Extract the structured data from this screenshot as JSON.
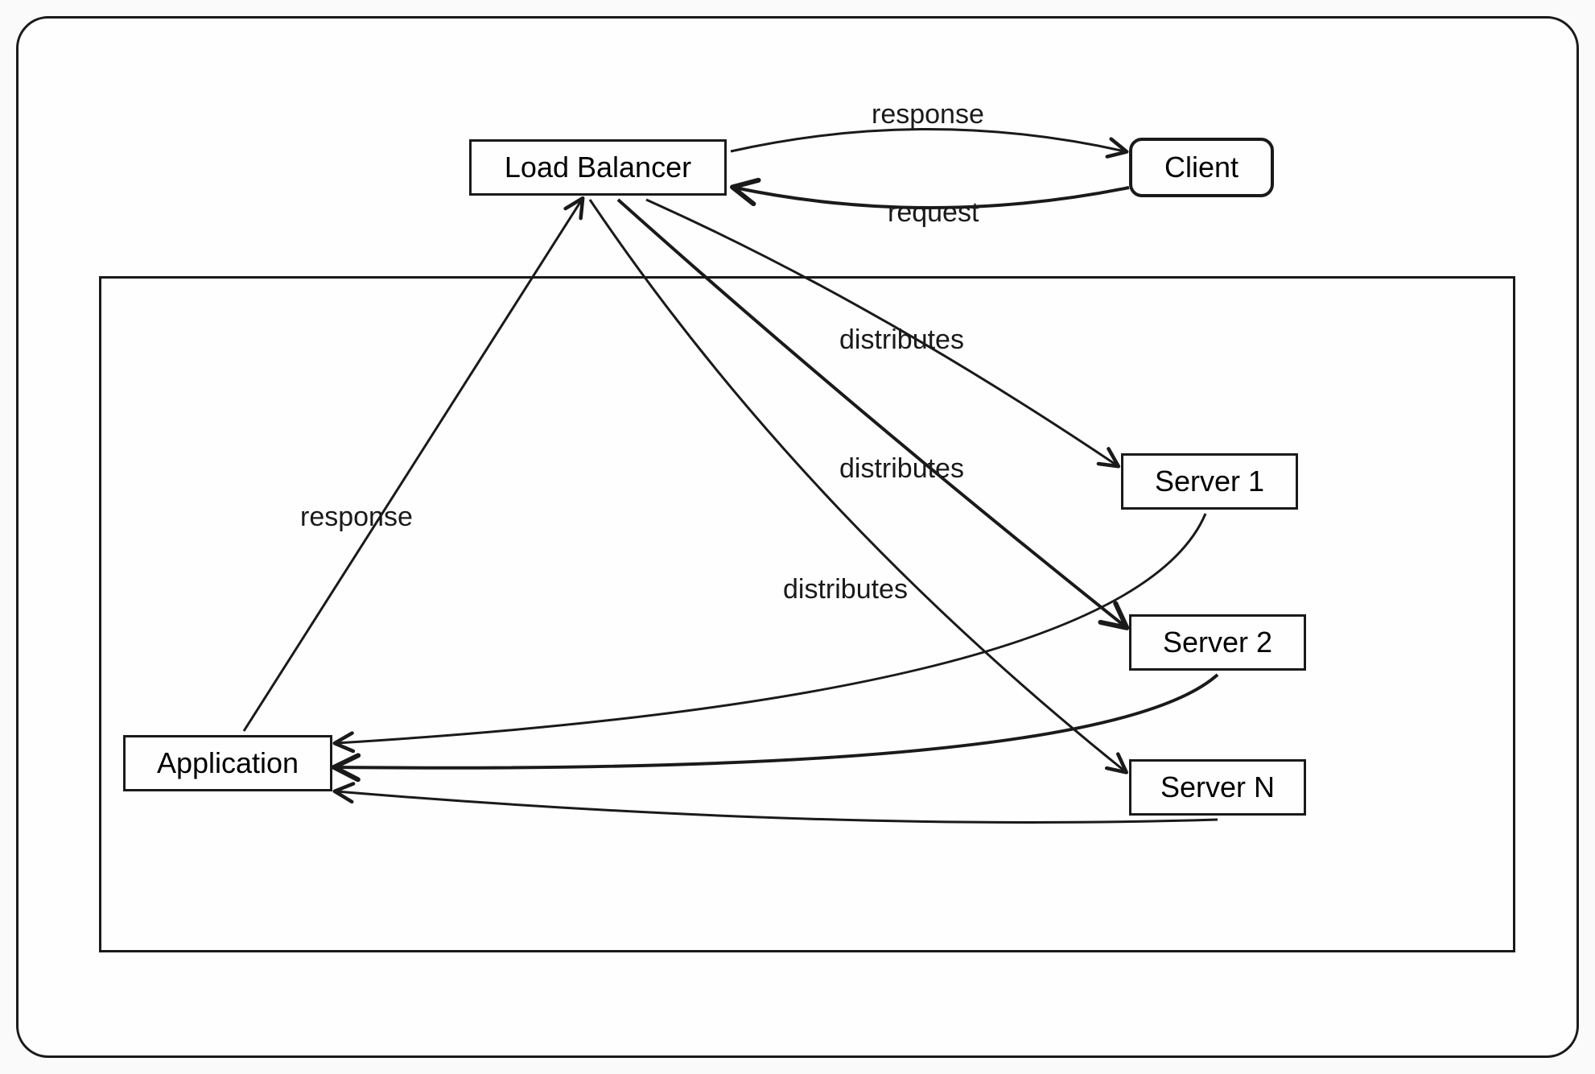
{
  "diagram": {
    "nodes": {
      "load_balancer": "Load Balancer",
      "client": "Client",
      "application": "Application",
      "server1": "Server 1",
      "server2": "Server 2",
      "serverN": "Server N"
    },
    "edges": {
      "lb_to_client": "response",
      "client_to_lb": "request",
      "lb_to_s1": "distributes",
      "lb_to_s2": "distributes",
      "lb_to_sN": "distributes",
      "app_to_lb": "response"
    }
  }
}
